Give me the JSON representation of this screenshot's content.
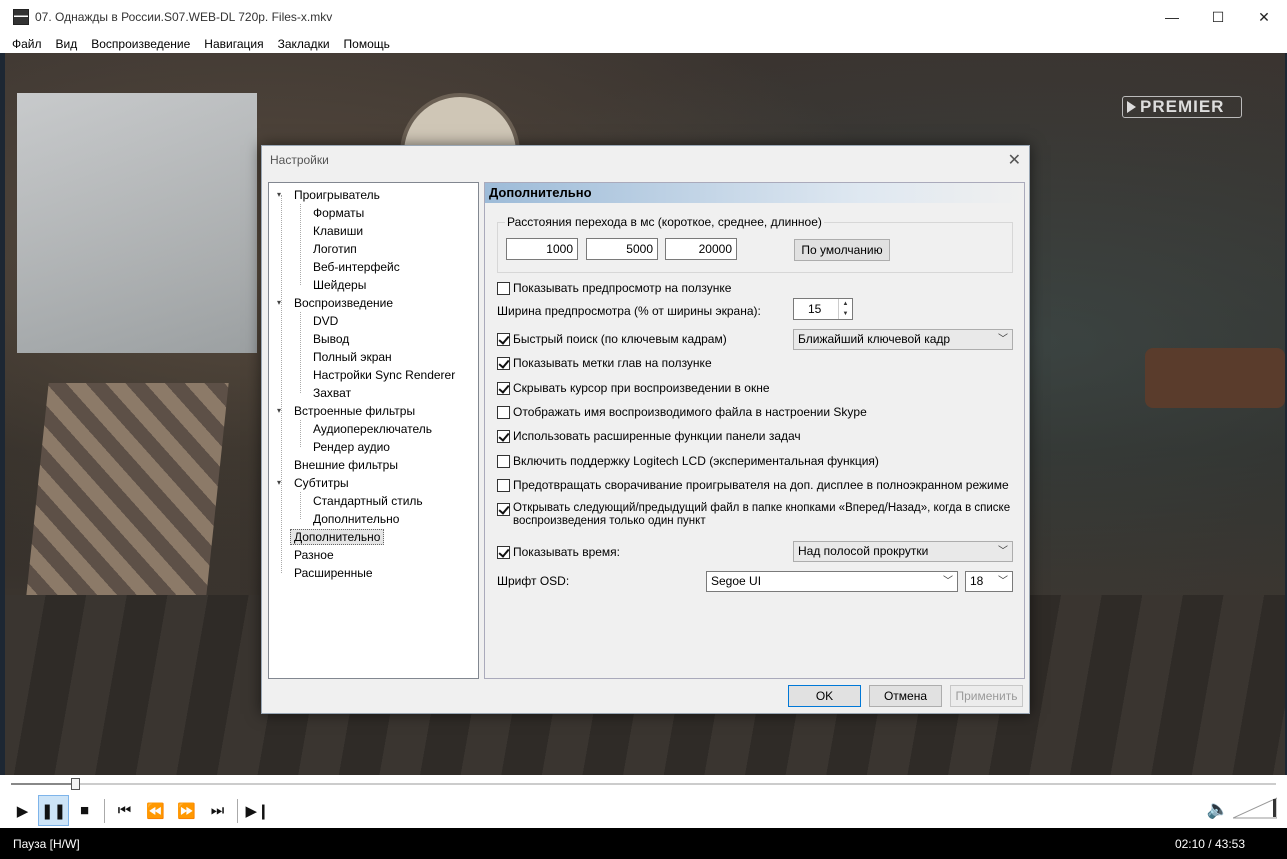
{
  "window": {
    "title": "07. Однажды в России.S07.WEB-DL 720p. Files-x.mkv",
    "minimize": "—",
    "maximize": "☐",
    "close": "✕"
  },
  "menu": [
    "Файл",
    "Вид",
    "Воспроизведение",
    "Навигация",
    "Закладки",
    "Помощь"
  ],
  "video": {
    "watermark": "PREMIER"
  },
  "playback": {
    "progress": 0.05
  },
  "status": {
    "state": "Пауза [H/W]",
    "time": "02:10 / 43:53"
  },
  "dialog": {
    "title": "Настройки",
    "close": "✕",
    "tree": [
      {
        "label": "Проигрыватель",
        "level": 0,
        "expander": "▾"
      },
      {
        "label": "Форматы",
        "level": 1
      },
      {
        "label": "Клавиши",
        "level": 1
      },
      {
        "label": "Логотип",
        "level": 1
      },
      {
        "label": "Веб-интерфейс",
        "level": 1
      },
      {
        "label": "Шейдеры",
        "level": 1
      },
      {
        "label": "Воспроизведение",
        "level": 0,
        "expander": "▾"
      },
      {
        "label": "DVD",
        "level": 1
      },
      {
        "label": "Вывод",
        "level": 1
      },
      {
        "label": "Полный экран",
        "level": 1
      },
      {
        "label": "Настройки Sync Renderer",
        "level": 1
      },
      {
        "label": "Захват",
        "level": 1
      },
      {
        "label": "Встроенные фильтры",
        "level": 0,
        "expander": "▾"
      },
      {
        "label": "Аудиопереключатель",
        "level": 1
      },
      {
        "label": "Рендер аудио",
        "level": 1
      },
      {
        "label": "Внешние фильтры",
        "level": 0
      },
      {
        "label": "Субтитры",
        "level": 0,
        "expander": "▾"
      },
      {
        "label": "Стандартный стиль",
        "level": 1
      },
      {
        "label": "Дополнительно",
        "level": 1
      },
      {
        "label": "Дополнительно",
        "level": 0,
        "selected": true
      },
      {
        "label": "Разное",
        "level": 0
      },
      {
        "label": "Расширенные",
        "level": 0
      }
    ],
    "panel": {
      "heading": "Дополнительно",
      "jump_group": {
        "title": "Расстояния перехода в мс (короткое, среднее, длинное)",
        "short": "1000",
        "medium": "5000",
        "long": "20000",
        "default_button": "По умолчанию"
      },
      "show_preview": {
        "label": "Показывать предпросмотр на ползунке",
        "checked": false
      },
      "preview_width": {
        "label": "Ширина предпросмотра (% от ширины экрана):",
        "value": "15"
      },
      "fast_seek": {
        "label": "Быстрый поиск (по ключевым кадрам)",
        "checked": true,
        "option": "Ближайший ключевой кадр"
      },
      "chapter_marks": {
        "label": "Показывать метки глав на ползунке",
        "checked": true
      },
      "hide_cursor": {
        "label": "Скрывать курсор при воспроизведении в окне",
        "checked": true
      },
      "skype": {
        "label": "Отображать имя воспроизводимого файла в настроении Skype",
        "checked": false
      },
      "taskbar": {
        "label": "Использовать расширенные функции панели задач",
        "checked": true
      },
      "logitech": {
        "label": "Включить поддержку Logitech LCD (экспериментальная функция)",
        "checked": false
      },
      "prevent_minimize": {
        "label": "Предотвращать сворачивание проигрывателя на доп. дисплее в полноэкранном режиме",
        "checked": false
      },
      "next_prev": {
        "label_line1": "Открывать следующий/предыдущий файл в папке кнопками «Вперед/Назад», когда в списке",
        "label_line2": "воспроизведения только один пункт",
        "checked": true
      },
      "show_time": {
        "label": "Показывать время:",
        "checked": true,
        "option": "Над полосой прокрутки"
      },
      "osd_font": {
        "label": "Шрифт OSD:",
        "font": "Segoe UI",
        "size": "18"
      }
    },
    "buttons": {
      "ok": "OK",
      "cancel": "Отмена",
      "apply": "Применить"
    }
  }
}
